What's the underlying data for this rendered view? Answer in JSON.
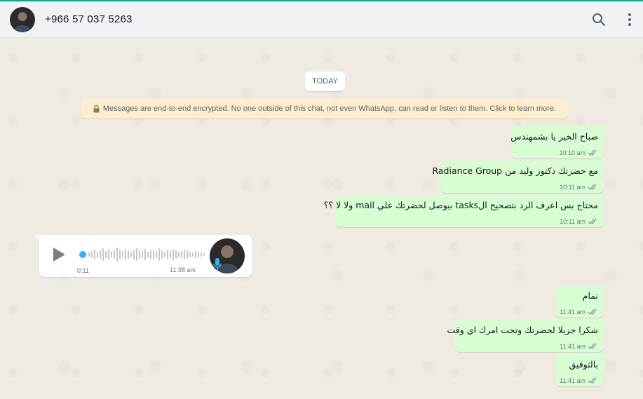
{
  "header": {
    "contact_name": "+966 57 037 5263"
  },
  "chat": {
    "date_chip": "TODAY",
    "encryption_notice": "Messages are end-to-end encrypted. No one outside of this chat, not even WhatsApp, can read or listen to them. Click to learn more.",
    "messages": [
      {
        "text": "صباح الخير يا بشمهندس",
        "time": "10:10 am"
      },
      {
        "text": "مع حضرتك دكتور وليد من Radiance Group",
        "time": "10:11 am"
      },
      {
        "text": "محتاج بس اعرف الرد بتصحيح الtasks بيوصل لحضرتك علي mail ولا لا ؟؟",
        "time": "10:11 am"
      },
      {
        "text": "تمام",
        "time": "11:41 am"
      },
      {
        "text": "شكرا جزيلا لحضرتك وتحت امرك اي وقت",
        "time": "11:41 am"
      },
      {
        "text": "بالتوفيق",
        "time": "11:41 am"
      }
    ],
    "voice_note": {
      "duration": "0:11",
      "time": "11:38 am"
    }
  },
  "icons": {
    "search": "search-icon",
    "menu": "menu-dots-icon",
    "lock": "lock-icon",
    "play": "play-icon",
    "mic": "microphone-icon",
    "read": "double-check-icon"
  },
  "colors": {
    "outgoing_bubble": "#d9fdd3",
    "incoming_bubble": "#ffffff",
    "read_ticks": "#8696a0",
    "mic_accent": "#34b7f1",
    "notice_bg": "#ffeecd"
  }
}
